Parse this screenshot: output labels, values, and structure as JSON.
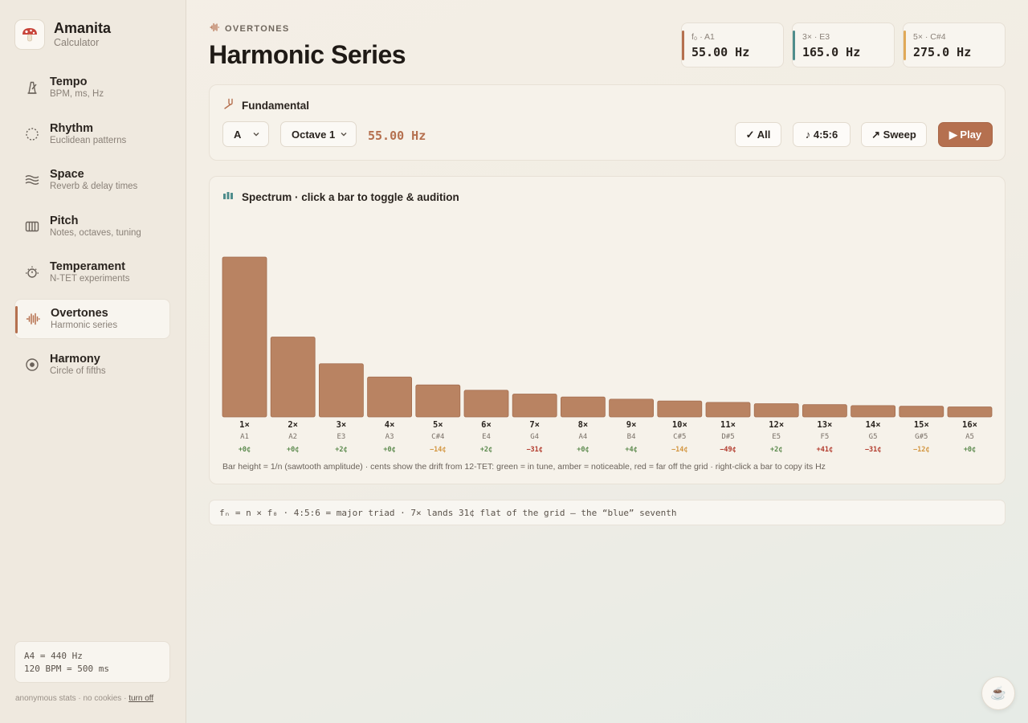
{
  "brand": {
    "name": "Amanita",
    "sub": "Calculator"
  },
  "nav": [
    {
      "title": "Tempo",
      "sub": "BPM, ms, Hz",
      "icon": "metronome-icon"
    },
    {
      "title": "Rhythm",
      "sub": "Euclidean patterns",
      "icon": "dotted-circle-icon"
    },
    {
      "title": "Space",
      "sub": "Reverb & delay times",
      "icon": "waves-icon"
    },
    {
      "title": "Pitch",
      "sub": "Notes, octaves, tuning",
      "icon": "piano-icon"
    },
    {
      "title": "Temperament",
      "sub": "N-TET experiments",
      "icon": "sun-timer-icon"
    },
    {
      "title": "Overtones",
      "sub": "Harmonic series",
      "icon": "waveform-icon",
      "active": true
    },
    {
      "title": "Harmony",
      "sub": "Circle of fifths",
      "icon": "target-circle-icon"
    }
  ],
  "reference": {
    "line1": "A4 = 440 Hz",
    "line2": "120 BPM = 500 ms"
  },
  "footer": {
    "text": "anonymous stats · no cookies · ",
    "link": "turn off"
  },
  "header": {
    "eyebrow": "OVERTONES",
    "title": "Harmonic Series"
  },
  "stats": [
    {
      "label": "f₀ · A1",
      "value": "55.00 Hz",
      "color": "#b5704f"
    },
    {
      "label": "3× · E3",
      "value": "165.0 Hz",
      "color": "#4f8d8c"
    },
    {
      "label": "5× · C#4",
      "value": "275.0 Hz",
      "color": "#e0a958"
    }
  ],
  "fundamental": {
    "title": "Fundamental",
    "note": "A",
    "octave": "Octave 1",
    "hz": "55.00 Hz",
    "buttons": {
      "all": "✓ All",
      "triad": "♪ 4:5:6",
      "sweep": "↗ Sweep",
      "play": "▶ Play"
    }
  },
  "spectrum": {
    "title": "Spectrum · click a bar to toggle & audition",
    "caption": "Bar height = 1/n (sawtooth amplitude) · cents show the drift from 12-TET: green = in tune, amber = noticeable, red = far off the grid · right-click a bar to copy its Hz"
  },
  "chart_data": {
    "type": "bar",
    "categories": [
      "1×",
      "2×",
      "3×",
      "4×",
      "5×",
      "6×",
      "7×",
      "8×",
      "9×",
      "10×",
      "11×",
      "12×",
      "13×",
      "14×",
      "15×",
      "16×"
    ],
    "values": [
      1,
      0.5,
      0.333,
      0.25,
      0.2,
      0.167,
      0.143,
      0.125,
      0.111,
      0.1,
      0.091,
      0.083,
      0.077,
      0.071,
      0.067,
      0.0625
    ],
    "notes": [
      "A1",
      "A2",
      "E3",
      "A3",
      "C#4",
      "E4",
      "G4",
      "A4",
      "B4",
      "C#5",
      "D#5",
      "E5",
      "F5",
      "G5",
      "G#5",
      "A5"
    ],
    "cents": [
      "+0¢",
      "+0¢",
      "+2¢",
      "+0¢",
      "−14¢",
      "+2¢",
      "−31¢",
      "+0¢",
      "+4¢",
      "−14¢",
      "−49¢",
      "+2¢",
      "+41¢",
      "−31¢",
      "−12¢",
      "+0¢"
    ],
    "cent_colors": [
      "#5c8a4e",
      "#5c8a4e",
      "#5c8a4e",
      "#5c8a4e",
      "#d39640",
      "#5c8a4e",
      "#b23a2c",
      "#5c8a4e",
      "#5c8a4e",
      "#d39640",
      "#b23a2c",
      "#5c8a4e",
      "#b23a2c",
      "#b23a2c",
      "#d39640",
      "#5c8a4e"
    ],
    "bar_color": "#b98362",
    "ylim": [
      0,
      1
    ]
  },
  "note": "fₙ = n × f₀  ·  4:5:6 = major triad  ·  7× lands 31¢ flat of the grid — the “blue” seventh",
  "coffee": "☕"
}
